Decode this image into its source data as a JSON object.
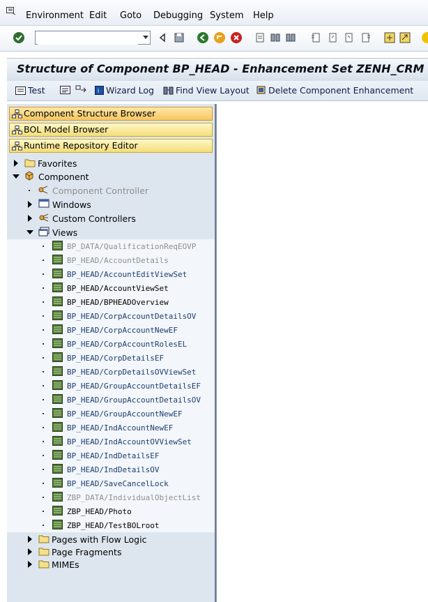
{
  "menu": {
    "items": [
      "Environment",
      "Edit",
      "Goto",
      "Debugging",
      "System",
      "Help"
    ]
  },
  "toolbar": {
    "command_value": "",
    "icons": [
      "enter-icon",
      "back-icon",
      "save-icon",
      "back-green-icon",
      "exit-icon",
      "cancel-icon",
      "print-icon",
      "find-icon",
      "find-next-icon",
      "first-page-icon",
      "previous-page-icon",
      "next-page-icon",
      "last-page-icon",
      "create-session-icon",
      "shortcut-icon",
      "help-icon"
    ]
  },
  "title": "Structure of Component BP_HEAD - Enhancement Set ZENH_CRM",
  "app_toolbar": {
    "test": "Test",
    "wizard_log": "Wizard Log",
    "find_view_layout": "Find View Layout",
    "delete_component_enhancement": "Delete Component Enhancement"
  },
  "left_buttons": [
    "Component Structure Browser",
    "BOL Model Browser",
    "Runtime Repository Editor"
  ],
  "tree": {
    "favorites": "Favorites",
    "component": "Component",
    "component_controller": "Component Controller",
    "windows": "Windows",
    "custom_controllers": "Custom Controllers",
    "views": "Views",
    "view_items": [
      {
        "label": "BP_DATA/QualificationReqEOVP",
        "state": "grey"
      },
      {
        "label": "BP_HEAD/AccountDetails",
        "state": "grey"
      },
      {
        "label": "BP_HEAD/AccountEditViewSet",
        "state": "blue"
      },
      {
        "label": "BP_HEAD/AccountViewSet",
        "state": "black"
      },
      {
        "label": "BP_HEAD/BPHEADOverview",
        "state": "black"
      },
      {
        "label": "BP_HEAD/CorpAccountDetailsOV",
        "state": "blue"
      },
      {
        "label": "BP_HEAD/CorpAccountNewEF",
        "state": "blue"
      },
      {
        "label": "BP_HEAD/CorpAccountRolesEL",
        "state": "blue"
      },
      {
        "label": "BP_HEAD/CorpDetailsEF",
        "state": "blue"
      },
      {
        "label": "BP_HEAD/CorpDetailsOVViewSet",
        "state": "blue"
      },
      {
        "label": "BP_HEAD/GroupAccountDetailsEF",
        "state": "blue"
      },
      {
        "label": "BP_HEAD/GroupAccountDetailsOV",
        "state": "blue"
      },
      {
        "label": "BP_HEAD/GroupAccountNewEF",
        "state": "blue"
      },
      {
        "label": "BP_HEAD/IndAccountNewEF",
        "state": "blue"
      },
      {
        "label": "BP_HEAD/IndAccountOVViewSet",
        "state": "blue"
      },
      {
        "label": "BP_HEAD/IndDetailsEF",
        "state": "blue"
      },
      {
        "label": "BP_HEAD/IndDetailsOV",
        "state": "blue"
      },
      {
        "label": "BP_HEAD/SaveCancelLock",
        "state": "blue"
      },
      {
        "label": "ZBP_DATA/IndividualObjectList",
        "state": "grey"
      },
      {
        "label": "ZBP_HEAD/Photo",
        "state": "black"
      },
      {
        "label": "ZBP_HEAD/TestBOLroot",
        "state": "black"
      }
    ],
    "pages_with_flow_logic": "Pages with Flow Logic",
    "page_fragments": "Page Fragments",
    "mimes": "MIMEs"
  }
}
